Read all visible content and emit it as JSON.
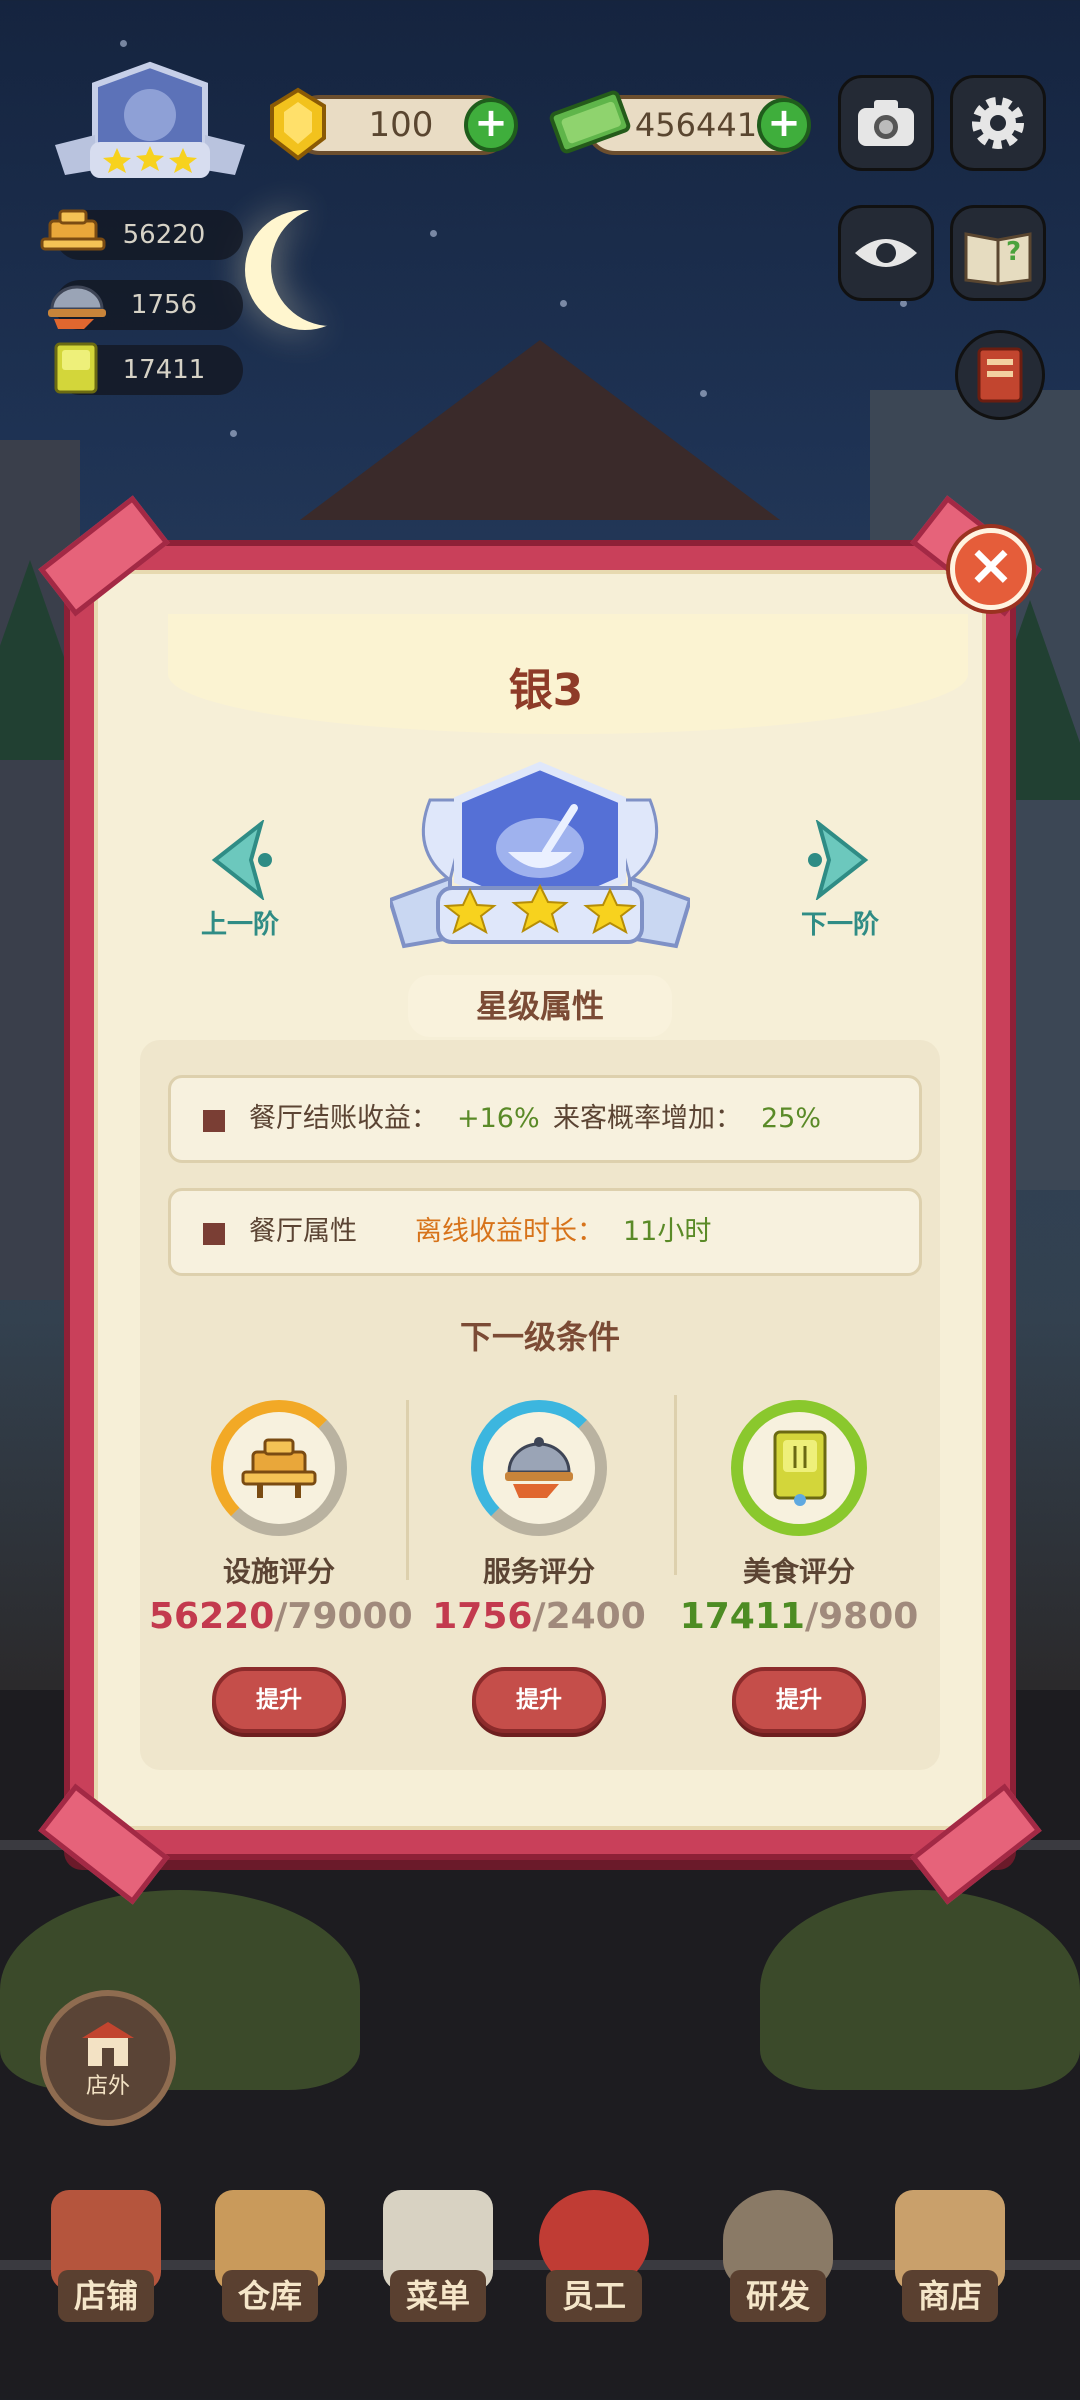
{
  "colors": {
    "dialog_frame": "#c9405a",
    "dialog_bg": "#f6efd7",
    "title": "#8e3b28",
    "arrow": "#2f8c85",
    "value_green": "#5a8a27",
    "value_orange": "#d7731a",
    "value_red": "#c33a4e",
    "button_red": "#c54e4a",
    "ring_facility": "#f2a926",
    "ring_service": "#3cb6df",
    "ring_food": "#8ac82d"
  },
  "hud": {
    "rank_stars": 3,
    "stats": [
      {
        "icon": "facility-icon",
        "value": "56220"
      },
      {
        "icon": "service-icon",
        "value": "1756"
      },
      {
        "icon": "food-book-icon",
        "value": "17411"
      }
    ],
    "gem": {
      "icon": "gem-icon",
      "value": "100"
    },
    "cash": {
      "icon": "cash-icon",
      "value": "456441"
    },
    "buttons": [
      "camera-icon",
      "gear-icon",
      "eye-icon",
      "guide-book-icon",
      "recipe-book-icon"
    ]
  },
  "dialog": {
    "title": "银3",
    "prev_label": "上一阶",
    "next_label": "下一阶",
    "medal_stars": 3,
    "star_section_label": "星级属性",
    "attributes": [
      {
        "label": "餐厅结账收益",
        "sep": "：",
        "value": "+16%",
        "label2": "来客概率增加",
        "sep2": "：",
        "value2": "25%"
      },
      {
        "label": "餐厅属性",
        "label2": "离线收益时长",
        "sep2": "：",
        "value2": "11小时"
      }
    ],
    "next_level_label": "下一级条件",
    "conditions": [
      {
        "name": "设施评分",
        "current": "56220",
        "target": "/79000",
        "progress": 0.71,
        "icon": "facility-icon",
        "button": "提升"
      },
      {
        "name": "服务评分",
        "current": "1756",
        "target": "/2400",
        "progress": 0.73,
        "icon": "service-icon",
        "button": "提升"
      },
      {
        "name": "美食评分",
        "current": "17411",
        "target": "/9800",
        "progress": 1.0,
        "icon": "food-book-icon",
        "button": "提升"
      }
    ]
  },
  "outside_button": {
    "label": "店外",
    "icon": "store-icon"
  },
  "bottom_nav": [
    {
      "label": "店铺",
      "icon": "shop-icon"
    },
    {
      "label": "仓库",
      "icon": "warehouse-box-icon"
    },
    {
      "label": "菜单",
      "icon": "menu-clipboard-icon"
    },
    {
      "label": "员工",
      "icon": "staff-chef-icon"
    },
    {
      "label": "研发",
      "icon": "research-pot-icon"
    },
    {
      "label": "商店",
      "icon": "store-icon"
    }
  ]
}
